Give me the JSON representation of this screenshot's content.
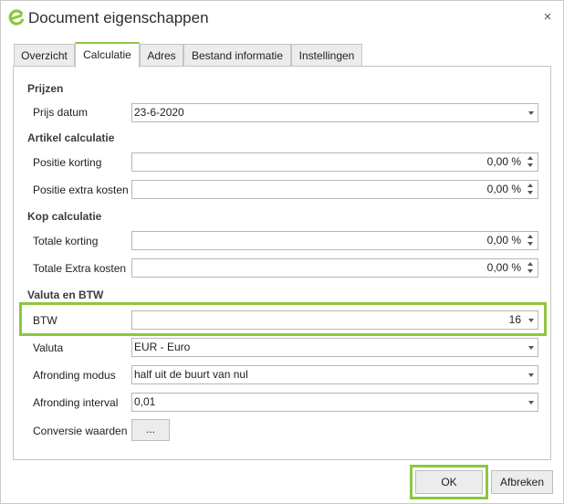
{
  "window": {
    "title": "Document eigenschappen",
    "close_symbol": "×",
    "brand_color": "#8cc63f"
  },
  "tabs": [
    {
      "label": "Overzicht",
      "active": false
    },
    {
      "label": "Calculatie",
      "active": true
    },
    {
      "label": "Adres",
      "active": false
    },
    {
      "label": "Bestand informatie",
      "active": false
    },
    {
      "label": "Instellingen",
      "active": false
    }
  ],
  "sections": {
    "prijzen": "Prijzen",
    "artikel": "Artikel calculatie",
    "kop": "Kop calculatie",
    "valuta": "Valuta en BTW"
  },
  "fields": {
    "prijs_datum": {
      "label": "Prijs datum",
      "value": "23-6-2020"
    },
    "positie_korting": {
      "label": "Positie korting",
      "value": "0,00 %"
    },
    "positie_extra_kosten": {
      "label": "Positie extra kosten",
      "value": "0,00 %"
    },
    "totale_korting": {
      "label": "Totale korting",
      "value": "0,00 %"
    },
    "totale_extra_kosten": {
      "label": "Totale Extra kosten",
      "value": "0,00 %"
    },
    "btw": {
      "label": "BTW",
      "value": "16"
    },
    "valuta": {
      "label": "Valuta",
      "value": "EUR - Euro"
    },
    "afronding_modus": {
      "label": "Afronding modus",
      "value": "half uit de buurt van nul"
    },
    "afronding_interval": {
      "label": "Afronding interval",
      "value": "0,01"
    },
    "conversie_waarden": {
      "label": "Conversie waarden",
      "button": "..."
    }
  },
  "buttons": {
    "ok": "OK",
    "cancel": "Afbreken"
  }
}
